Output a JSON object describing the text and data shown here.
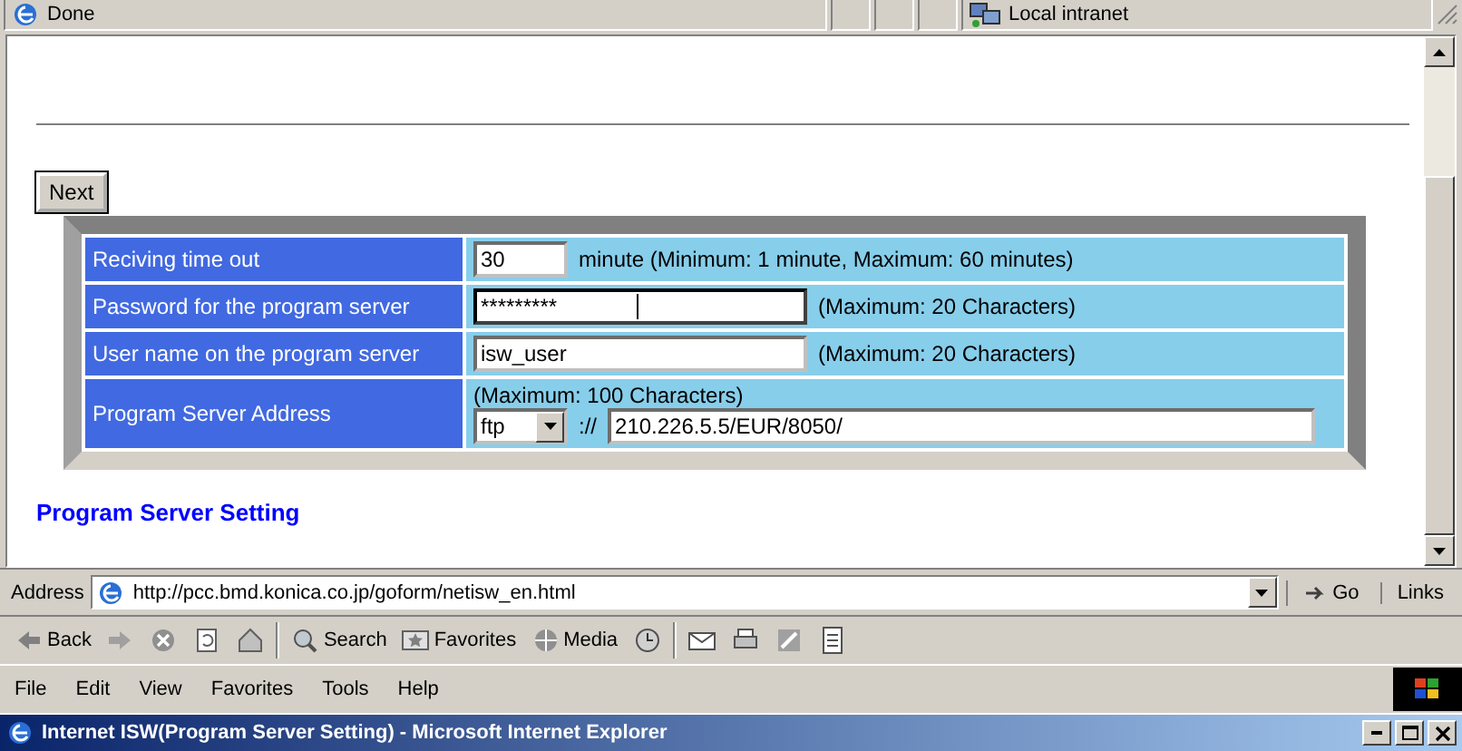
{
  "status_bar": {
    "text": "Done",
    "zone": "Local intranet"
  },
  "page": {
    "next": "Next",
    "rows": [
      {
        "kind": "short",
        "label": "Reciving time out",
        "value": "30",
        "note": "minute (Minimum: 1 minute, Maximum: 60 minutes)"
      },
      {
        "kind": "text",
        "label": "Password for the program server",
        "value": "*********",
        "note": "(Maximum: 20 Characters)",
        "focused": true
      },
      {
        "kind": "text",
        "label": "User name on the program server",
        "value": "isw_user",
        "note": "(Maximum: 20 Characters)"
      },
      {
        "kind": "address",
        "label": "Program Server Address",
        "note": "(Maximum: 100 Characters)",
        "protocol": "ftp",
        "separator": "://",
        "value": "210.226.5.5/EUR/8050/"
      }
    ],
    "heading": "Program Server Setting"
  },
  "address_bar": {
    "label": "Address",
    "url": "http://pcc.bmd.konica.co.jp/goform/netisw_en.html",
    "go": "Go",
    "links": "Links"
  },
  "toolbar": [
    {
      "kind": "back",
      "label": "Back"
    },
    {
      "kind": "forward"
    },
    {
      "kind": "stop"
    },
    {
      "kind": "refresh"
    },
    {
      "kind": "home"
    },
    {
      "kind": "search",
      "label": "Search"
    },
    {
      "kind": "favorites",
      "label": "Favorites"
    },
    {
      "kind": "media",
      "label": "Media"
    },
    {
      "kind": "history"
    },
    {
      "kind": "mail"
    },
    {
      "kind": "print"
    },
    {
      "kind": "edit"
    },
    {
      "kind": "discuss"
    }
  ],
  "menu": [
    "File",
    "Edit",
    "View",
    "Favorites",
    "Tools",
    "Help"
  ],
  "window": {
    "title": "Internet ISW(Program Server Setting) - Microsoft Internet Explorer"
  }
}
